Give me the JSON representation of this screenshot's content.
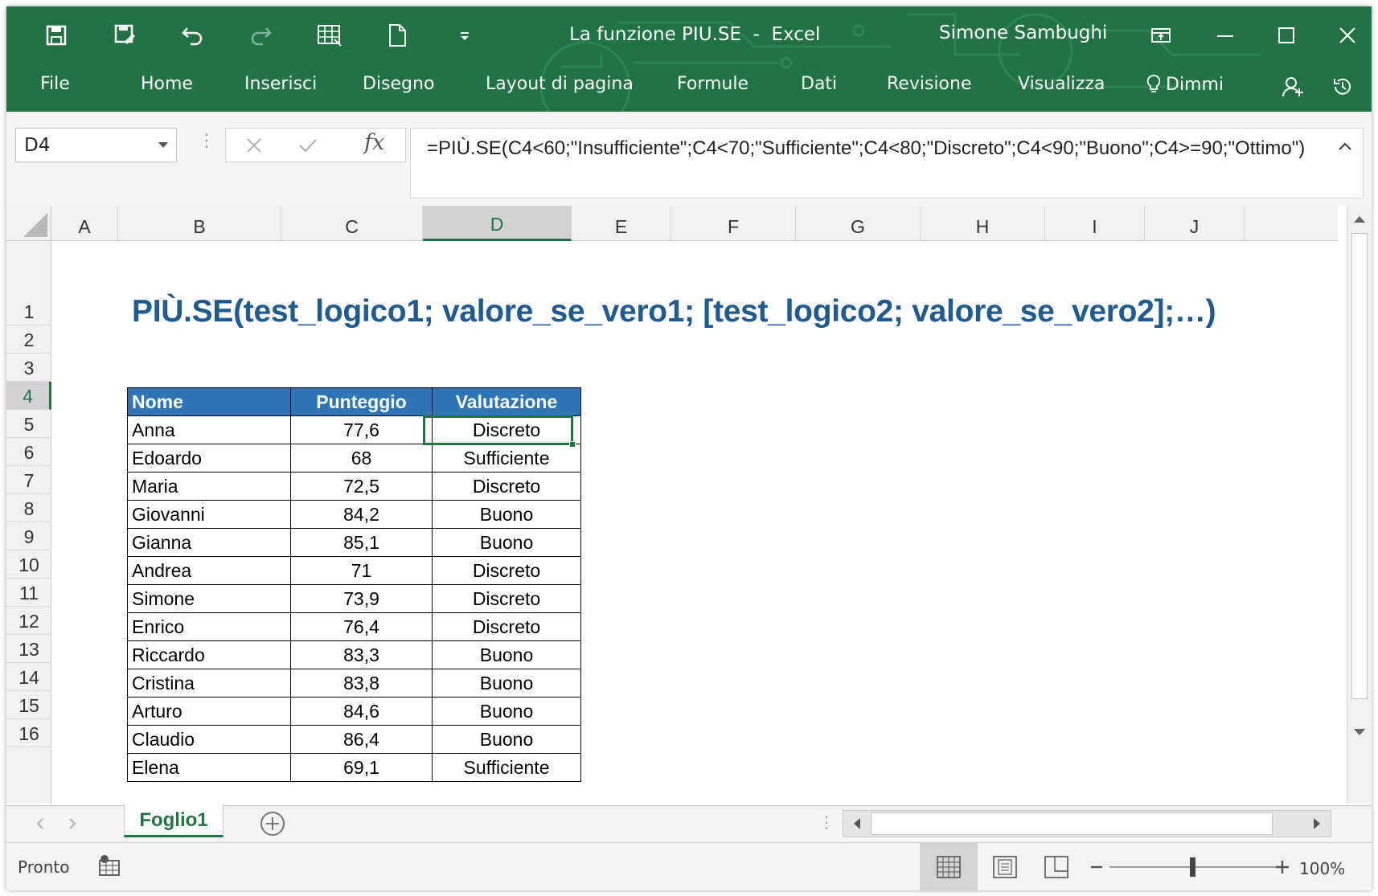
{
  "window": {
    "title": "La funzione PIU.SE  -  Excel",
    "user": "Simone Sambughi"
  },
  "tabs": [
    "File",
    "Home",
    "Inserisci",
    "Disegno",
    "Layout di pagina",
    "Formule",
    "Dati",
    "Revisione",
    "Visualizza"
  ],
  "tell_me": "Dimmi",
  "name_box": "D4",
  "formula": "=PIÙ.SE(C4<60;\"Insufficiente\";C4<70;\"Sufficiente\";C4<80;\"Discreto\";C4<90;\"Buono\";C4>=90;\"Ottimo\")",
  "columns": [
    "A",
    "B",
    "C",
    "D",
    "E",
    "F",
    "G",
    "H",
    "I",
    "J"
  ],
  "active_column": "D",
  "rows": [
    "1",
    "2",
    "3",
    "4",
    "5",
    "6",
    "7",
    "8",
    "9",
    "10",
    "11",
    "12",
    "13",
    "14",
    "15",
    "16"
  ],
  "active_row": "4",
  "sheet_title": "PIÙ.SE(test_logico1; valore_se_vero1; [test_logico2; valore_se_vero2];…)",
  "table": {
    "headers": [
      "Nome",
      "Punteggio",
      "Valutazione"
    ],
    "rows": [
      [
        "Anna",
        "77,6",
        "Discreto"
      ],
      [
        "Edoardo",
        "68",
        "Sufficiente"
      ],
      [
        "Maria",
        "72,5",
        "Discreto"
      ],
      [
        "Giovanni",
        "84,2",
        "Buono"
      ],
      [
        "Gianna",
        "85,1",
        "Buono"
      ],
      [
        "Andrea",
        "71",
        "Discreto"
      ],
      [
        "Simone",
        "73,9",
        "Discreto"
      ],
      [
        "Enrico",
        "76,4",
        "Discreto"
      ],
      [
        "Riccardo",
        "83,3",
        "Buono"
      ],
      [
        "Cristina",
        "83,8",
        "Buono"
      ],
      [
        "Arturo",
        "84,6",
        "Buono"
      ],
      [
        "Claudio",
        "86,4",
        "Buono"
      ],
      [
        "Elena",
        "69,1",
        "Sufficiente"
      ]
    ]
  },
  "sheet_tab": "Foglio1",
  "status": "Pronto",
  "zoom": "100%",
  "colors": {
    "ribbon": "#217346",
    "header_fill": "#2e75b6",
    "title_text": "#1f5b91"
  }
}
